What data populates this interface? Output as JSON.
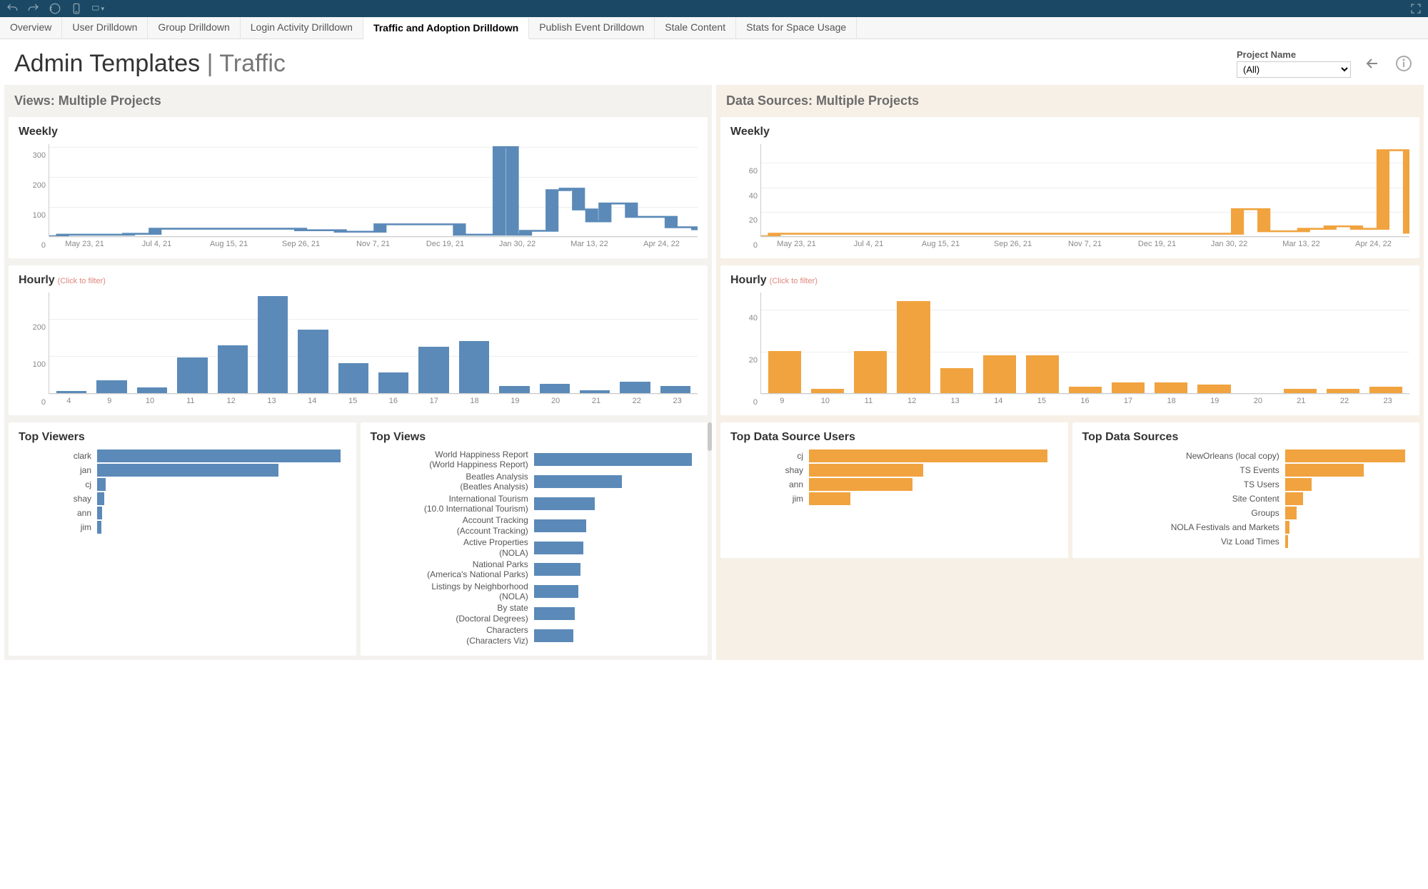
{
  "toolbar_icons": [
    "undo-icon",
    "redo-icon",
    "revert-icon",
    "save-icon",
    "presentation-icon"
  ],
  "tabs": [
    "Overview",
    "User Drilldown",
    "Group Drilldown",
    "Login Activity Drilldown",
    "Traffic and Adoption Drilldown",
    "Publish Event Drilldown",
    "Stale Content",
    "Stats for Space Usage"
  ],
  "active_tab": "Traffic and Adoption Drilldown",
  "title_a": "Admin Templates",
  "title_b": "Traffic",
  "filter": {
    "label": "Project Name",
    "value": "(All)"
  },
  "left": {
    "section": "Views: Multiple Projects",
    "weekly_title": "Weekly",
    "hourly_title": "Hourly",
    "hourly_hint": "(Click to filter)",
    "top_viewers_title": "Top Viewers",
    "top_views_title": "Top Views",
    "top_viewers": [
      {
        "name": "clark",
        "v": 235
      },
      {
        "name": "jan",
        "v": 175
      },
      {
        "name": "cj",
        "v": 8
      },
      {
        "name": "shay",
        "v": 7
      },
      {
        "name": "ann",
        "v": 5
      },
      {
        "name": "jim",
        "v": 4
      }
    ],
    "top_views": [
      {
        "l1": "World Happiness Report",
        "l2": "(World Happiness Report)",
        "v": 135
      },
      {
        "l1": "Beatles Analysis",
        "l2": "(Beatles Analysis)",
        "v": 75
      },
      {
        "l1": "International Tourism",
        "l2": "(10.0 International Tourism)",
        "v": 52
      },
      {
        "l1": "Account Tracking",
        "l2": "(Account Tracking)",
        "v": 45
      },
      {
        "l1": "Active Properties",
        "l2": "(NOLA)",
        "v": 42
      },
      {
        "l1": "National Parks",
        "l2": "(America's National Parks)",
        "v": 40
      },
      {
        "l1": "Listings by Neighborhood",
        "l2": "(NOLA)",
        "v": 38
      },
      {
        "l1": "By state",
        "l2": "(Doctoral Degrees)",
        "v": 35
      },
      {
        "l1": "Characters",
        "l2": "(Characters Viz)",
        "v": 34
      }
    ]
  },
  "right": {
    "section": "Data Sources: Multiple Projects",
    "weekly_title": "Weekly",
    "hourly_title": "Hourly",
    "hourly_hint": "(Click to filter)",
    "top_users_title": "Top Data Source Users",
    "top_sources_title": "Top Data Sources",
    "top_users": [
      {
        "name": "cj",
        "v": 230
      },
      {
        "name": "shay",
        "v": 110
      },
      {
        "name": "ann",
        "v": 100
      },
      {
        "name": "jim",
        "v": 40
      }
    ],
    "top_sources": [
      {
        "name": "NewOrleans (local copy)",
        "v": 145
      },
      {
        "name": "TS Events",
        "v": 95
      },
      {
        "name": "TS Users",
        "v": 32
      },
      {
        "name": "Site Content",
        "v": 22
      },
      {
        "name": "Groups",
        "v": 14
      },
      {
        "name": "NOLA Festivals and Markets",
        "v": 5
      },
      {
        "name": "Viz Load Times",
        "v": 4
      }
    ]
  },
  "chart_data": [
    {
      "type": "line",
      "id": "views_weekly",
      "title": "Views – Weekly",
      "color": "#5b8ab8",
      "x_ticks": [
        "May 23, 21",
        "Jul 4, 21",
        "Aug 15, 21",
        "Sep 26, 21",
        "Nov 7, 21",
        "Dec 19, 21",
        "Jan 30, 22",
        "Mar 13, 22",
        "Apr 24, 22"
      ],
      "y_ticks": [
        0,
        100,
        200,
        300
      ],
      "ylim": [
        0,
        310
      ],
      "values": [
        0,
        5,
        5,
        5,
        5,
        5,
        8,
        8,
        25,
        25,
        25,
        25,
        25,
        25,
        25,
        25,
        25,
        25,
        25,
        20,
        20,
        20,
        15,
        15,
        15,
        40,
        40,
        40,
        40,
        40,
        40,
        5,
        5,
        5,
        300,
        5,
        18,
        18,
        155,
        160,
        90,
        50,
        110,
        110,
        65,
        65,
        65,
        30,
        30,
        20
      ]
    },
    {
      "type": "line",
      "id": "ds_weekly",
      "title": "Data Sources – Weekly",
      "color": "#f0a33f",
      "x_ticks": [
        "May 23, 21",
        "Jul 4, 21",
        "Aug 15, 21",
        "Sep 26, 21",
        "Nov 7, 21",
        "Dec 19, 21",
        "Jan 30, 22",
        "Mar 13, 22",
        "Apr 24, 22"
      ],
      "y_ticks": [
        0,
        20,
        40,
        60
      ],
      "ylim": [
        0,
        75
      ],
      "values": [
        0,
        2,
        2,
        2,
        2,
        2,
        2,
        2,
        2,
        2,
        2,
        2,
        2,
        2,
        2,
        2,
        2,
        2,
        2,
        2,
        2,
        2,
        2,
        2,
        2,
        2,
        2,
        2,
        2,
        2,
        2,
        2,
        2,
        2,
        2,
        2,
        22,
        22,
        4,
        4,
        4,
        6,
        6,
        8,
        8,
        6,
        6,
        70,
        70,
        2
      ]
    },
    {
      "type": "bar",
      "id": "views_hourly",
      "title": "Views – Hourly",
      "color": "#5b8ab8",
      "categories": [
        "4",
        "9",
        "10",
        "11",
        "12",
        "13",
        "14",
        "15",
        "16",
        "17",
        "18",
        "19",
        "20",
        "21",
        "22",
        "23"
      ],
      "y_ticks": [
        0,
        100,
        200
      ],
      "ylim": [
        0,
        270
      ],
      "values": [
        5,
        35,
        15,
        95,
        128,
        260,
        170,
        80,
        55,
        125,
        140,
        20,
        25,
        8,
        30,
        20
      ]
    },
    {
      "type": "bar",
      "id": "ds_hourly",
      "title": "Data Sources – Hourly",
      "color": "#f0a33f",
      "categories": [
        "9",
        "10",
        "11",
        "12",
        "13",
        "14",
        "15",
        "16",
        "17",
        "18",
        "19",
        "20",
        "21",
        "22",
        "23"
      ],
      "y_ticks": [
        0,
        20,
        40
      ],
      "ylim": [
        0,
        48
      ],
      "values": [
        20,
        2,
        20,
        44,
        12,
        18,
        18,
        3,
        5,
        5,
        4,
        0,
        2,
        2,
        3
      ]
    },
    {
      "type": "bar",
      "id": "top_viewers",
      "orientation": "h",
      "title": "Top Viewers",
      "color": "#5b8ab8",
      "xlim": [
        0,
        240
      ],
      "categories": [
        "clark",
        "jan",
        "cj",
        "shay",
        "ann",
        "jim"
      ],
      "values": [
        235,
        175,
        8,
        7,
        5,
        4
      ]
    },
    {
      "type": "bar",
      "id": "top_views",
      "orientation": "h",
      "title": "Top Views",
      "color": "#5b8ab8",
      "xlim": [
        0,
        140
      ],
      "categories": [
        "World Happiness Report",
        "Beatles Analysis",
        "International Tourism",
        "Account Tracking",
        "Active Properties",
        "National Parks",
        "Listings by Neighborhood",
        "By state",
        "Characters"
      ],
      "values": [
        135,
        75,
        52,
        45,
        42,
        40,
        38,
        35,
        34
      ]
    },
    {
      "type": "bar",
      "id": "top_ds_users",
      "orientation": "h",
      "title": "Top Data Source Users",
      "color": "#f0a33f",
      "xlim": [
        0,
        240
      ],
      "categories": [
        "cj",
        "shay",
        "ann",
        "jim"
      ],
      "values": [
        230,
        110,
        100,
        40
      ]
    },
    {
      "type": "bar",
      "id": "top_ds",
      "orientation": "h",
      "title": "Top Data Sources",
      "color": "#f0a33f",
      "xlim": [
        0,
        150
      ],
      "categories": [
        "NewOrleans (local copy)",
        "TS Events",
        "TS Users",
        "Site Content",
        "Groups",
        "NOLA Festivals and Markets",
        "Viz Load Times"
      ],
      "values": [
        145,
        95,
        32,
        22,
        14,
        5,
        4
      ]
    }
  ]
}
